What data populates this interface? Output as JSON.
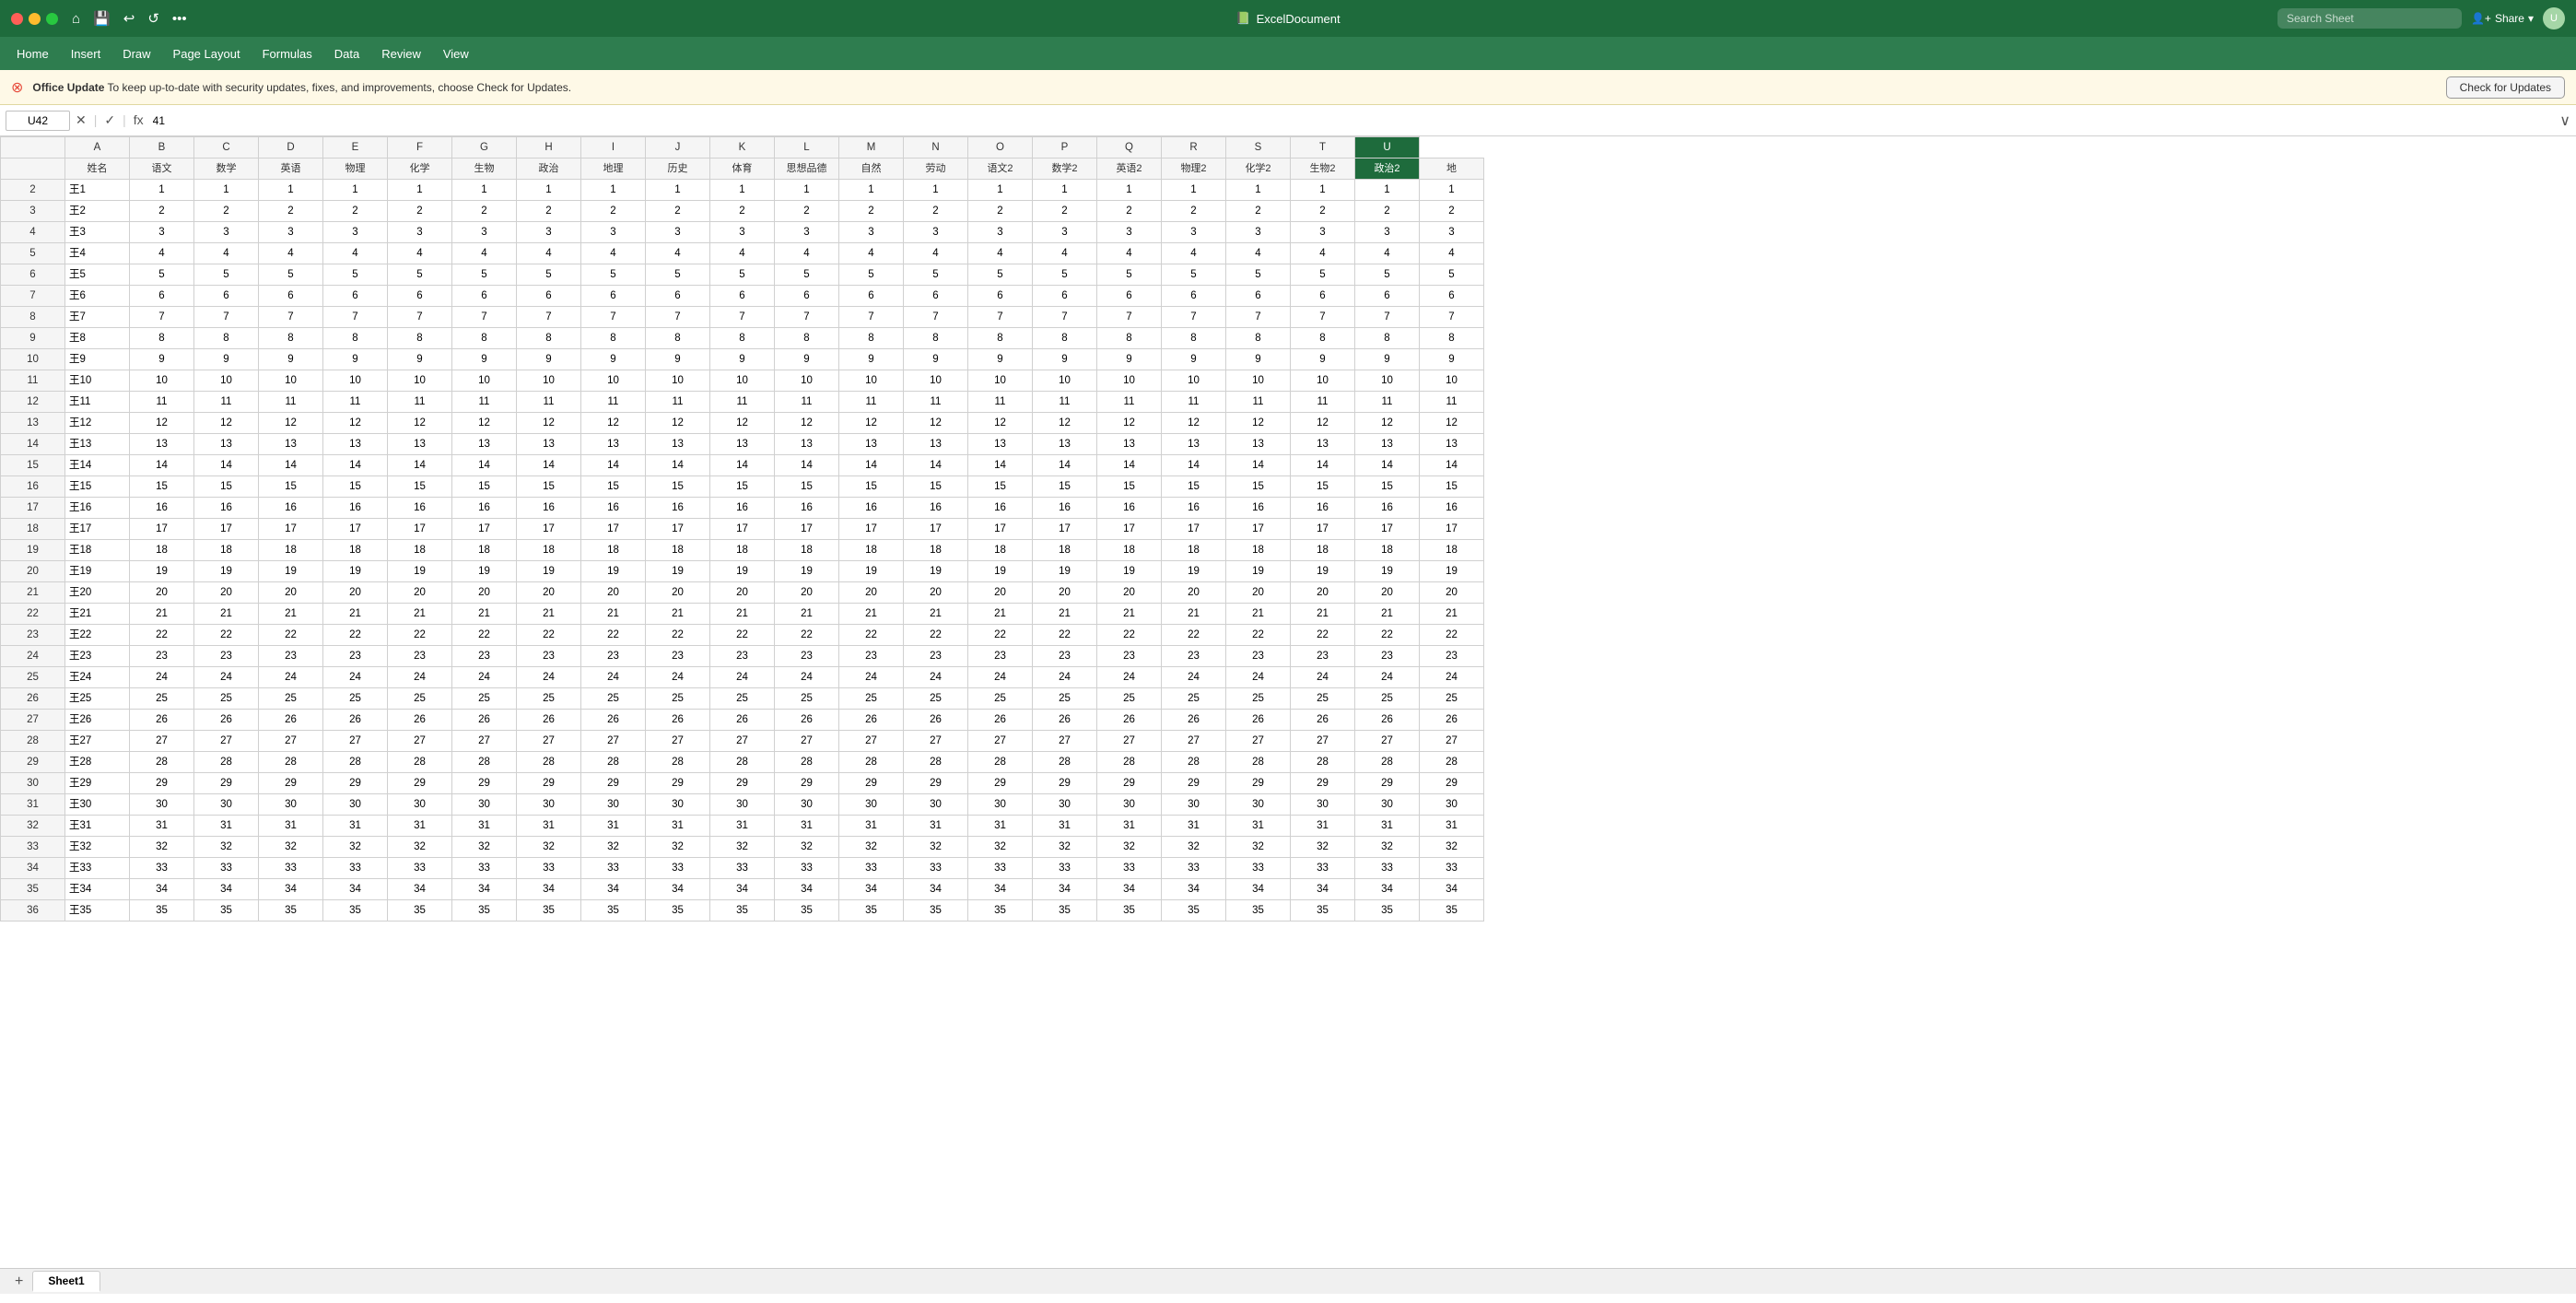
{
  "titleBar": {
    "appName": "ExcelDocument",
    "searchPlaceholder": "Search Sheet",
    "shareLabel": "Share",
    "icon": "📗"
  },
  "updateBanner": {
    "iconLabel": "⊗",
    "boldText": "Office Update",
    "message": "  To keep up-to-date with security updates, fixes, and improvements, choose Check for Updates.",
    "checkUpdatesLabel": "Check for Updates"
  },
  "formulaBar": {
    "cellRef": "U42",
    "formula": "41",
    "expandIcon": "∨"
  },
  "toolbar": {
    "items": [
      "Home",
      "Insert",
      "Draw",
      "Page Layout",
      "Formulas",
      "Data",
      "Review",
      "View"
    ]
  },
  "columns": [
    "A",
    "B",
    "C",
    "D",
    "E",
    "F",
    "G",
    "H",
    "I",
    "J",
    "K",
    "L",
    "M",
    "N",
    "O",
    "P",
    "Q",
    "R",
    "S",
    "T",
    "U"
  ],
  "columnHeaders": [
    "姓名",
    "语文",
    "数学",
    "英语",
    "物理",
    "化学",
    "生物",
    "政治",
    "地理",
    "历史",
    "体育",
    "思想品德",
    "自然",
    "劳动",
    "语文2",
    "数学2",
    "英语2",
    "物理2",
    "化学2",
    "生物2",
    "政治2",
    "地"
  ],
  "rows": [
    [
      "王1",
      1,
      1,
      1,
      1,
      1,
      1,
      1,
      1,
      1,
      1,
      1,
      1,
      1,
      1,
      1,
      1,
      1,
      1,
      1,
      1,
      1
    ],
    [
      "王2",
      2,
      2,
      2,
      2,
      2,
      2,
      2,
      2,
      2,
      2,
      2,
      2,
      2,
      2,
      2,
      2,
      2,
      2,
      2,
      2,
      2
    ],
    [
      "王3",
      3,
      3,
      3,
      3,
      3,
      3,
      3,
      3,
      3,
      3,
      3,
      3,
      3,
      3,
      3,
      3,
      3,
      3,
      3,
      3,
      3
    ],
    [
      "王4",
      4,
      4,
      4,
      4,
      4,
      4,
      4,
      4,
      4,
      4,
      4,
      4,
      4,
      4,
      4,
      4,
      4,
      4,
      4,
      4,
      4
    ],
    [
      "王5",
      5,
      5,
      5,
      5,
      5,
      5,
      5,
      5,
      5,
      5,
      5,
      5,
      5,
      5,
      5,
      5,
      5,
      5,
      5,
      5,
      5
    ],
    [
      "王6",
      6,
      6,
      6,
      6,
      6,
      6,
      6,
      6,
      6,
      6,
      6,
      6,
      6,
      6,
      6,
      6,
      6,
      6,
      6,
      6,
      6
    ],
    [
      "王7",
      7,
      7,
      7,
      7,
      7,
      7,
      7,
      7,
      7,
      7,
      7,
      7,
      7,
      7,
      7,
      7,
      7,
      7,
      7,
      7,
      7
    ],
    [
      "王8",
      8,
      8,
      8,
      8,
      8,
      8,
      8,
      8,
      8,
      8,
      8,
      8,
      8,
      8,
      8,
      8,
      8,
      8,
      8,
      8,
      8
    ],
    [
      "王9",
      9,
      9,
      9,
      9,
      9,
      9,
      9,
      9,
      9,
      9,
      9,
      9,
      9,
      9,
      9,
      9,
      9,
      9,
      9,
      9,
      9
    ],
    [
      "王10",
      10,
      10,
      10,
      10,
      10,
      10,
      10,
      10,
      10,
      10,
      10,
      10,
      10,
      10,
      10,
      10,
      10,
      10,
      10,
      10,
      10
    ],
    [
      "王11",
      11,
      11,
      11,
      11,
      11,
      11,
      11,
      11,
      11,
      11,
      11,
      11,
      11,
      11,
      11,
      11,
      11,
      11,
      11,
      11,
      11
    ],
    [
      "王12",
      12,
      12,
      12,
      12,
      12,
      12,
      12,
      12,
      12,
      12,
      12,
      12,
      12,
      12,
      12,
      12,
      12,
      12,
      12,
      12,
      12
    ],
    [
      "王13",
      13,
      13,
      13,
      13,
      13,
      13,
      13,
      13,
      13,
      13,
      13,
      13,
      13,
      13,
      13,
      13,
      13,
      13,
      13,
      13,
      13
    ],
    [
      "王14",
      14,
      14,
      14,
      14,
      14,
      14,
      14,
      14,
      14,
      14,
      14,
      14,
      14,
      14,
      14,
      14,
      14,
      14,
      14,
      14,
      14
    ],
    [
      "王15",
      15,
      15,
      15,
      15,
      15,
      15,
      15,
      15,
      15,
      15,
      15,
      15,
      15,
      15,
      15,
      15,
      15,
      15,
      15,
      15,
      15
    ],
    [
      "王16",
      16,
      16,
      16,
      16,
      16,
      16,
      16,
      16,
      16,
      16,
      16,
      16,
      16,
      16,
      16,
      16,
      16,
      16,
      16,
      16,
      16
    ],
    [
      "王17",
      17,
      17,
      17,
      17,
      17,
      17,
      17,
      17,
      17,
      17,
      17,
      17,
      17,
      17,
      17,
      17,
      17,
      17,
      17,
      17,
      17
    ],
    [
      "王18",
      18,
      18,
      18,
      18,
      18,
      18,
      18,
      18,
      18,
      18,
      18,
      18,
      18,
      18,
      18,
      18,
      18,
      18,
      18,
      18,
      18
    ],
    [
      "王19",
      19,
      19,
      19,
      19,
      19,
      19,
      19,
      19,
      19,
      19,
      19,
      19,
      19,
      19,
      19,
      19,
      19,
      19,
      19,
      19,
      19
    ],
    [
      "王20",
      20,
      20,
      20,
      20,
      20,
      20,
      20,
      20,
      20,
      20,
      20,
      20,
      20,
      20,
      20,
      20,
      20,
      20,
      20,
      20,
      20
    ],
    [
      "王21",
      21,
      21,
      21,
      21,
      21,
      21,
      21,
      21,
      21,
      21,
      21,
      21,
      21,
      21,
      21,
      21,
      21,
      21,
      21,
      21,
      21
    ],
    [
      "王22",
      22,
      22,
      22,
      22,
      22,
      22,
      22,
      22,
      22,
      22,
      22,
      22,
      22,
      22,
      22,
      22,
      22,
      22,
      22,
      22,
      22
    ],
    [
      "王23",
      23,
      23,
      23,
      23,
      23,
      23,
      23,
      23,
      23,
      23,
      23,
      23,
      23,
      23,
      23,
      23,
      23,
      23,
      23,
      23,
      23
    ],
    [
      "王24",
      24,
      24,
      24,
      24,
      24,
      24,
      24,
      24,
      24,
      24,
      24,
      24,
      24,
      24,
      24,
      24,
      24,
      24,
      24,
      24,
      24
    ],
    [
      "王25",
      25,
      25,
      25,
      25,
      25,
      25,
      25,
      25,
      25,
      25,
      25,
      25,
      25,
      25,
      25,
      25,
      25,
      25,
      25,
      25,
      25
    ],
    [
      "王26",
      26,
      26,
      26,
      26,
      26,
      26,
      26,
      26,
      26,
      26,
      26,
      26,
      26,
      26,
      26,
      26,
      26,
      26,
      26,
      26,
      26
    ],
    [
      "王27",
      27,
      27,
      27,
      27,
      27,
      27,
      27,
      27,
      27,
      27,
      27,
      27,
      27,
      27,
      27,
      27,
      27,
      27,
      27,
      27,
      27
    ],
    [
      "王28",
      28,
      28,
      28,
      28,
      28,
      28,
      28,
      28,
      28,
      28,
      28,
      28,
      28,
      28,
      28,
      28,
      28,
      28,
      28,
      28,
      28
    ],
    [
      "王29",
      29,
      29,
      29,
      29,
      29,
      29,
      29,
      29,
      29,
      29,
      29,
      29,
      29,
      29,
      29,
      29,
      29,
      29,
      29,
      29,
      29
    ],
    [
      "王30",
      30,
      30,
      30,
      30,
      30,
      30,
      30,
      30,
      30,
      30,
      30,
      30,
      30,
      30,
      30,
      30,
      30,
      30,
      30,
      30,
      30
    ],
    [
      "王31",
      31,
      31,
      31,
      31,
      31,
      31,
      31,
      31,
      31,
      31,
      31,
      31,
      31,
      31,
      31,
      31,
      31,
      31,
      31,
      31,
      31
    ],
    [
      "王32",
      32,
      32,
      32,
      32,
      32,
      32,
      32,
      32,
      32,
      32,
      32,
      32,
      32,
      32,
      32,
      32,
      32,
      32,
      32,
      32,
      32
    ],
    [
      "王33",
      33,
      33,
      33,
      33,
      33,
      33,
      33,
      33,
      33,
      33,
      33,
      33,
      33,
      33,
      33,
      33,
      33,
      33,
      33,
      33,
      33
    ],
    [
      "王34",
      34,
      34,
      34,
      34,
      34,
      34,
      34,
      34,
      34,
      34,
      34,
      34,
      34,
      34,
      34,
      34,
      34,
      34,
      34,
      34,
      34
    ],
    [
      "王35",
      35,
      35,
      35,
      35,
      35,
      35,
      35,
      35,
      35,
      35,
      35,
      35,
      35,
      35,
      35,
      35,
      35,
      35,
      35,
      35,
      35
    ]
  ],
  "sheets": [
    "Sheet1"
  ],
  "selectedCell": "U42",
  "selectedCol": "U"
}
